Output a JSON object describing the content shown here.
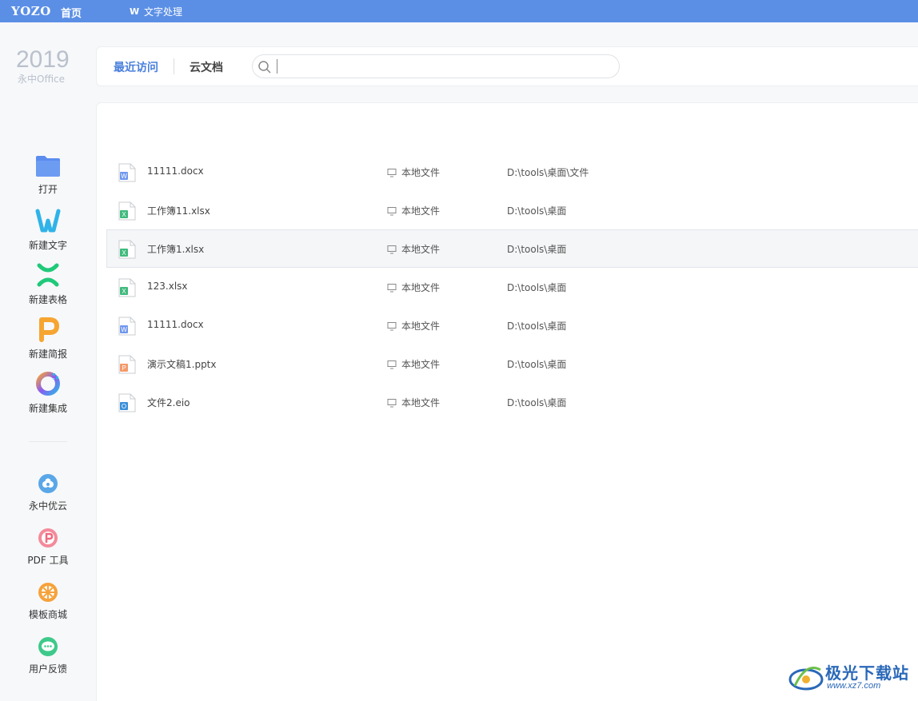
{
  "titlebar": {
    "logo": "YOZO",
    "home": "首页",
    "doc_tab_icon": "W",
    "doc_tab": "文字处理"
  },
  "sidebar": {
    "year": "2019",
    "product": "永中Office",
    "actions": [
      {
        "label": "打开",
        "icon": "folder-icon"
      },
      {
        "label": "新建文字",
        "icon": "word-w-icon"
      },
      {
        "label": "新建表格",
        "icon": "sheet-x-icon"
      },
      {
        "label": "新建简报",
        "icon": "slide-p-icon"
      },
      {
        "label": "新建集成",
        "icon": "integrated-o-icon"
      }
    ],
    "tools": [
      {
        "label": "永中优云",
        "icon": "cloud-icon"
      },
      {
        "label": "PDF 工具",
        "icon": "pdf-icon"
      },
      {
        "label": "模板商城",
        "icon": "template-store-icon"
      },
      {
        "label": "用户反馈",
        "icon": "feedback-icon"
      }
    ]
  },
  "topbar": {
    "tab_recent": "最近访问",
    "tab_cloud": "云文档",
    "search_placeholder": ""
  },
  "files": [
    {
      "name": "11111.docx",
      "type": "w",
      "location": "本地文件",
      "path": "D:\\tools\\桌面\\文件"
    },
    {
      "name": "工作簿11.xlsx",
      "type": "x",
      "location": "本地文件",
      "path": "D:\\tools\\桌面"
    },
    {
      "name": "工作簿1.xlsx",
      "type": "x",
      "location": "本地文件",
      "path": "D:\\tools\\桌面"
    },
    {
      "name": "123.xlsx",
      "type": "x",
      "location": "本地文件",
      "path": "D:\\tools\\桌面"
    },
    {
      "name": "11111.docx",
      "type": "w",
      "location": "本地文件",
      "path": "D:\\tools\\桌面"
    },
    {
      "name": "演示文稿1.pptx",
      "type": "p",
      "location": "本地文件",
      "path": "D:\\tools\\桌面"
    },
    {
      "name": "文件2.eio",
      "type": "o",
      "location": "本地文件",
      "path": "D:\\tools\\桌面"
    }
  ],
  "colors": {
    "titlebar": "#5b8fe6",
    "accent": "#4a7fdc",
    "word": "#5b8def",
    "sheet": "#3fba7d",
    "slide": "#f4a23c",
    "eio": "#3a8fd8"
  },
  "watermark": {
    "title": "极光下载站",
    "url": "www.xz7.com"
  }
}
